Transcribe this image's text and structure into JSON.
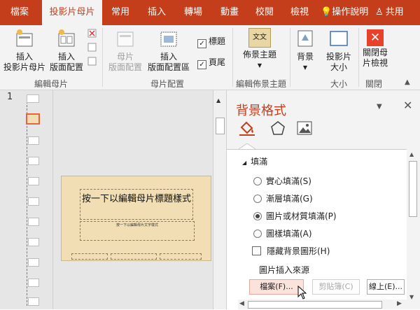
{
  "tabs": [
    {
      "label": "檔案",
      "active": false
    },
    {
      "label": "投影片母片",
      "active": true
    },
    {
      "label": "常用",
      "active": false
    },
    {
      "label": "插入",
      "active": false
    },
    {
      "label": "轉場",
      "active": false
    },
    {
      "label": "動畫",
      "active": false
    },
    {
      "label": "校閱",
      "active": false
    },
    {
      "label": "檢視",
      "active": false
    }
  ],
  "tell_me": "操作說明",
  "share": "共用",
  "ribbon": {
    "insert_master": "插入\n投影片母片",
    "insert_layout": "插入\n版面配置",
    "group_edit_master": "編輯母片",
    "master_layout": "母片\n版面配置",
    "insert_placeholder": "插入\n版面配置區",
    "chk_title": "標題",
    "chk_footer": "頁尾",
    "group_master_layout": "母片配置",
    "themes": "佈景主題",
    "themes_icon_text": "文文",
    "group_edit_theme": "編輯佈景主題",
    "background": "背景",
    "slide_size": "投影片\n大小",
    "group_size": "大小",
    "close_master": "關閉母\n片檢視",
    "group_close": "關閉"
  },
  "thumb_number": "1",
  "slide": {
    "title": "按一下以編輯母片標題樣式",
    "subtitle": "按一下以編輯母片文字樣式"
  },
  "pane": {
    "title": "背景格式",
    "section": "填滿",
    "options": [
      {
        "label": "實心填滿(S)",
        "selected": false
      },
      {
        "label": "漸層填滿(G)",
        "selected": false
      },
      {
        "label": "圖片或材質填滿(P)",
        "selected": true
      },
      {
        "label": "圖樣填滿(A)",
        "selected": false
      }
    ],
    "hide_bg": "隱藏背景圖形(H)",
    "source_label": "圖片插入來源",
    "btn_file": "檔案(F)...",
    "btn_clipboard": "剪貼簿(C)",
    "btn_online": "線上(E)..."
  },
  "colors": {
    "accent": "#c43e1c",
    "close_red": "#e8412c"
  }
}
